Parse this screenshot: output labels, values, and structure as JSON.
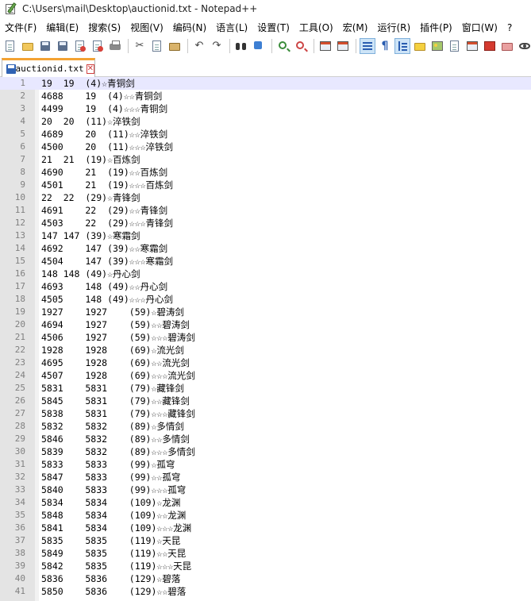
{
  "window": {
    "title": "C:\\Users\\mail\\Desktop\\auctionid.txt - Notepad++"
  },
  "menu": [
    "文件(F)",
    "编辑(E)",
    "搜索(S)",
    "视图(V)",
    "编码(N)",
    "语言(L)",
    "设置(T)",
    "工具(O)",
    "宏(M)",
    "运行(R)",
    "插件(P)",
    "窗口(W)",
    "?"
  ],
  "tab": {
    "label": "auctionid.txt",
    "close_glyph": "✕"
  },
  "editor": {
    "current_line": 1,
    "lines": [
      "19  19  (4)☆青铜剑",
      "4688    19  (4)☆☆青铜剑",
      "4499    19  (4)☆☆☆青铜剑",
      "20  20  (11)☆淬铁剑",
      "4689    20  (11)☆☆淬铁剑",
      "4500    20  (11)☆☆☆淬铁剑",
      "21  21  (19)☆百炼剑",
      "4690    21  (19)☆☆百炼剑",
      "4501    21  (19)☆☆☆百炼剑",
      "22  22  (29)☆青锋剑",
      "4691    22  (29)☆☆青锋剑",
      "4503    22  (29)☆☆☆青锋剑",
      "147 147 (39)☆寒霜剑",
      "4692    147 (39)☆☆寒霜剑",
      "4504    147 (39)☆☆☆寒霜剑",
      "148 148 (49)☆丹心剑",
      "4693    148 (49)☆☆丹心剑",
      "4505    148 (49)☆☆☆丹心剑",
      "1927    1927    (59)☆碧涛剑",
      "4694    1927    (59)☆☆碧涛剑",
      "4506    1927    (59)☆☆☆碧涛剑",
      "1928    1928    (69)☆流光剑",
      "4695    1928    (69)☆☆流光剑",
      "4507    1928    (69)☆☆☆流光剑",
      "5831    5831    (79)☆藏锋剑",
      "5845    5831    (79)☆☆藏锋剑",
      "5838    5831    (79)☆☆☆藏锋剑",
      "5832    5832    (89)☆多情剑",
      "5846    5832    (89)☆☆多情剑",
      "5839    5832    (89)☆☆☆多情剑",
      "5833    5833    (99)☆孤穹",
      "5847    5833    (99)☆☆孤穹",
      "5840    5833    (99)☆☆☆孤穹",
      "5834    5834    (109)☆龙渊",
      "5848    5834    (109)☆☆龙渊",
      "5841    5834    (109)☆☆☆龙渊",
      "5835    5835    (119)☆天昆",
      "5849    5835    (119)☆☆天昆",
      "5842    5835    (119)☆☆☆天昆",
      "5836    5836    (129)☆碧落",
      "5850    5836    (129)☆☆碧落"
    ]
  }
}
